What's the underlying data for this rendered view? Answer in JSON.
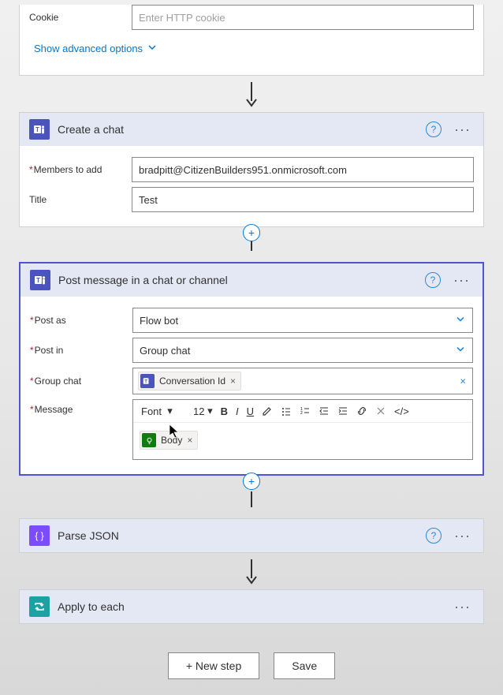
{
  "first_card": {
    "cookie_label": "Cookie",
    "cookie_placeholder": "Enter HTTP cookie",
    "advanced_link": "Show advanced options"
  },
  "create_chat": {
    "title": "Create a chat",
    "members_label": "Members to add",
    "members_value": "bradpitt@CitizenBuilders951.onmicrosoft.com",
    "title_label": "Title",
    "title_value": "Test"
  },
  "post_message": {
    "title": "Post message in a chat or channel",
    "post_as_label": "Post as",
    "post_as_value": "Flow bot",
    "post_in_label": "Post in",
    "post_in_value": "Group chat",
    "group_chat_label": "Group chat",
    "group_chat_pill": "Conversation Id",
    "message_label": "Message",
    "font_label": "Font",
    "font_size": "12",
    "body_pill": "Body"
  },
  "parse_json": {
    "title": "Parse JSON"
  },
  "apply_each": {
    "title": "Apply to each"
  },
  "buttons": {
    "new_step": "+ New step",
    "save": "Save"
  }
}
